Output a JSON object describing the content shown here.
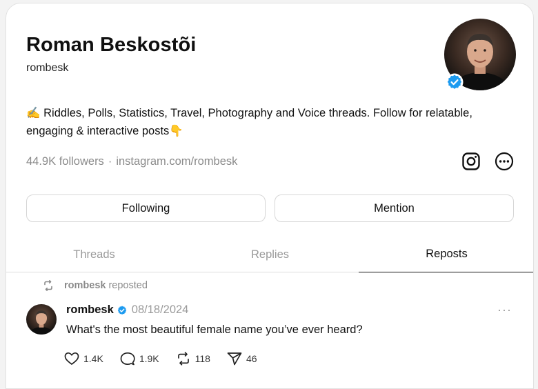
{
  "profile": {
    "name": "Roman Beskostõi",
    "handle": "rombesk",
    "bio_line1": "✍️ Riddles, Polls, Statistics, Travel, Photography and Voice threads. Follow for relatable,",
    "bio_line2": "engaging & interactive posts👇",
    "followers": "44.9K followers",
    "separator": "·",
    "link": "instagram.com/rombesk"
  },
  "buttons": {
    "following": "Following",
    "mention": "Mention"
  },
  "tabs": [
    {
      "label": "Threads",
      "active": false
    },
    {
      "label": "Replies",
      "active": false
    },
    {
      "label": "Reposts",
      "active": true
    }
  ],
  "post": {
    "repost_user": "rombesk",
    "repost_text": "reposted",
    "user": "rombesk",
    "date": "08/18/2024",
    "more": "···",
    "text": "What's the most beautiful female name you’ve ever heard?",
    "likes": "1.4K",
    "replies": "1.9K",
    "reposts": "118",
    "shares": "46"
  },
  "colors": {
    "verified": "#1d9bf0",
    "muted": "#8a8a8a"
  }
}
